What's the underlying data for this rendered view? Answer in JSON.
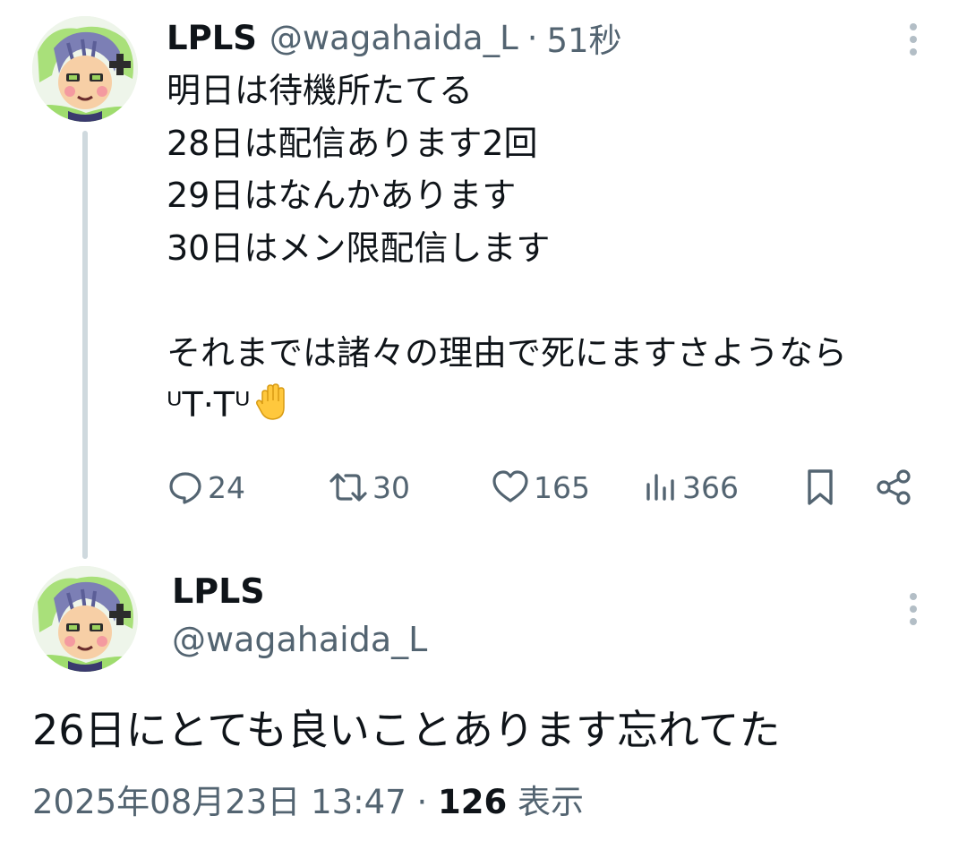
{
  "tweet1": {
    "author_name": "LPLS",
    "handle": "@wagahaida_L",
    "separator": "·",
    "time": "51秒",
    "lines": [
      "明日は待機所たてる",
      "28日は配信あります2回",
      "29日はなんかあります",
      "30日はメン限配信します",
      "",
      "それまでは諸々の理由で死にますさようなら",
      "ᵁT·Tᵁ"
    ],
    "emoji": "raised-hand",
    "stats": {
      "replies": "24",
      "retweets": "30",
      "likes": "165",
      "views": "366"
    }
  },
  "tweet2": {
    "author_name": "LPLS",
    "handle": "@wagahaida_L",
    "text": "26日にとても良いことあります忘れてた",
    "date": "2025年08月23日 13:47",
    "separator": "·",
    "views_count": "126",
    "views_label": "表示"
  },
  "icons": {
    "reply": "speech-bubble-icon",
    "retweet": "retweet-icon",
    "like": "heart-icon",
    "views": "bar-chart-icon",
    "bookmark": "bookmark-icon",
    "share": "share-icon",
    "more": "vertical-dots-icon"
  },
  "colors": {
    "text_primary": "#0f1419",
    "text_secondary": "#536471",
    "thread_line": "#cfd9de",
    "more_dots": "#b3bec6"
  }
}
